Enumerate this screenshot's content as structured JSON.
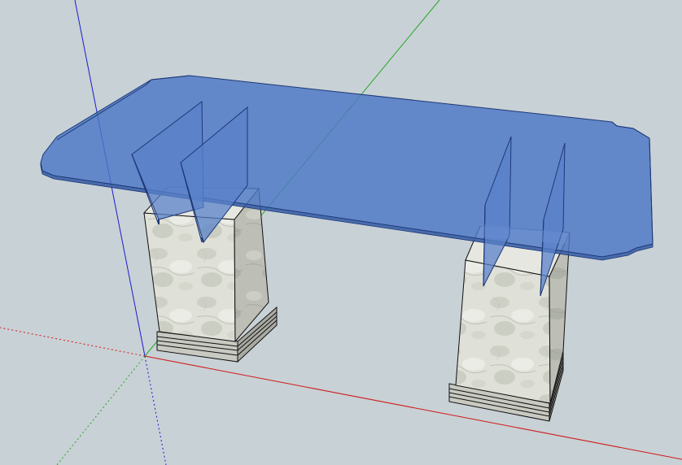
{
  "app": {
    "viewport_background": "#c8d1d5"
  },
  "axes": {
    "red_color": "#cc1111",
    "green_color": "#22aa22",
    "blue_color": "#1111cc"
  },
  "model": {
    "glass_color": "#4f78c4",
    "glass_edge_color": "#1f3a78",
    "stone_color": "#e2e4dc",
    "stone_shade_color": "#b9bcb3",
    "outline_color": "#111111"
  }
}
